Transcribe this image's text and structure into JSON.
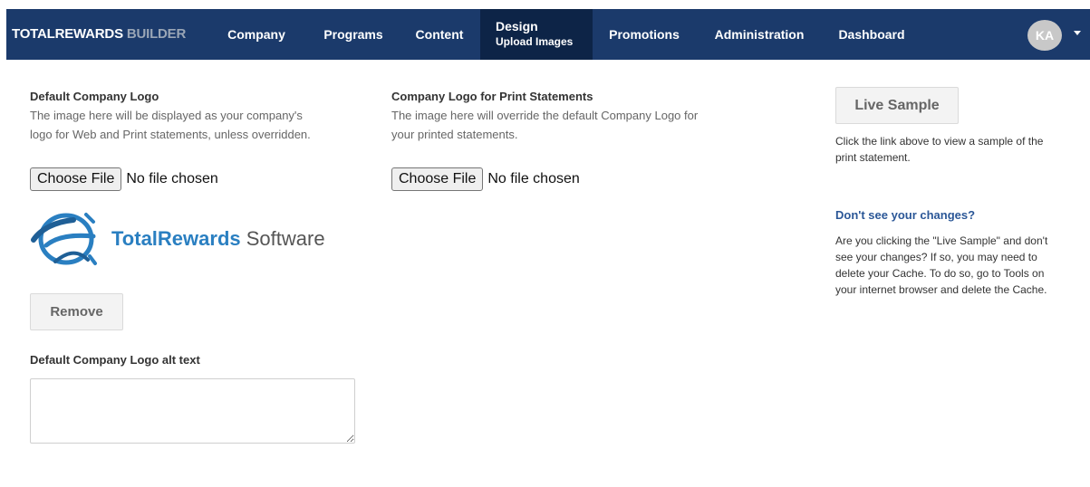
{
  "brand": {
    "part1": "TOTALREWARDS",
    "part2": "BUILDER"
  },
  "nav": {
    "company": "Company",
    "programs": "Programs",
    "content": "Content",
    "design": "Design",
    "design_sub": "Upload Images",
    "promotions": "Promotions",
    "administration": "Administration",
    "dashboard": "Dashboard"
  },
  "user": {
    "initials": "KA"
  },
  "default_logo": {
    "title": "Default Company Logo",
    "desc_line1": "The image here will be displayed as your company's",
    "desc_line2": "logo for Web and Print statements, unless overridden.",
    "choose_label": "Choose File",
    "no_file": "No file chosen",
    "logo_text_a": "TotalRewards",
    "logo_text_b": "Software",
    "remove_label": "Remove",
    "alt_label": "Default Company Logo alt text",
    "alt_value": ""
  },
  "print_logo": {
    "title": "Company Logo for Print Statements",
    "desc_line1": "The image here will override the default Company Logo for",
    "desc_line2": "your printed statements.",
    "choose_label": "Choose File",
    "no_file": "No file chosen"
  },
  "sidebar": {
    "live_sample_label": "Live Sample",
    "live_desc_line1": "Click the link above to view a sample of the",
    "live_desc_line2": "print statement.",
    "help_title": "Don't see your changes?",
    "help_line1": "Are you clicking the \"Live Sample\" and don't",
    "help_line2": "see your changes? If so, you may need to",
    "help_line3": "delete your Cache. To do so, go to Tools on",
    "help_line4": "your internet browser and delete the Cache."
  },
  "colors": {
    "navbar": "#1b3a6b",
    "nav_active": "#0d2447",
    "link_blue": "#2b5797",
    "logo_blue": "#2a7fc1"
  }
}
